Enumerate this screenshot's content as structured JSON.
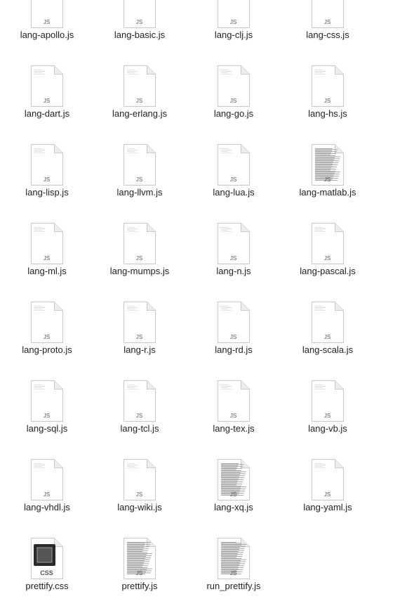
{
  "files": [
    {
      "name": "lang-apollo.js",
      "ext": "JS",
      "icon": "js-file-icon",
      "dense": false
    },
    {
      "name": "lang-basic.js",
      "ext": "JS",
      "icon": "js-file-icon",
      "dense": false
    },
    {
      "name": "lang-clj.js",
      "ext": "JS",
      "icon": "js-file-icon",
      "dense": false
    },
    {
      "name": "lang-css.js",
      "ext": "JS",
      "icon": "js-file-icon",
      "dense": false
    },
    {
      "name": "lang-dart.js",
      "ext": "JS",
      "icon": "js-file-icon",
      "dense": false
    },
    {
      "name": "lang-erlang.js",
      "ext": "JS",
      "icon": "js-file-icon",
      "dense": false
    },
    {
      "name": "lang-go.js",
      "ext": "JS",
      "icon": "js-file-icon",
      "dense": false
    },
    {
      "name": "lang-hs.js",
      "ext": "JS",
      "icon": "js-file-icon",
      "dense": false
    },
    {
      "name": "lang-lisp.js",
      "ext": "JS",
      "icon": "js-file-icon",
      "dense": false
    },
    {
      "name": "lang-llvm.js",
      "ext": "JS",
      "icon": "js-file-icon",
      "dense": false
    },
    {
      "name": "lang-lua.js",
      "ext": "JS",
      "icon": "js-file-icon",
      "dense": false
    },
    {
      "name": "lang-matlab.js",
      "ext": "JS",
      "icon": "js-file-icon",
      "dense": true
    },
    {
      "name": "lang-ml.js",
      "ext": "JS",
      "icon": "js-file-icon",
      "dense": false
    },
    {
      "name": "lang-mumps.js",
      "ext": "JS",
      "icon": "js-file-icon",
      "dense": false
    },
    {
      "name": "lang-n.js",
      "ext": "JS",
      "icon": "js-file-icon",
      "dense": false
    },
    {
      "name": "lang-pascal.js",
      "ext": "JS",
      "icon": "js-file-icon",
      "dense": false
    },
    {
      "name": "lang-proto.js",
      "ext": "JS",
      "icon": "js-file-icon",
      "dense": false
    },
    {
      "name": "lang-r.js",
      "ext": "JS",
      "icon": "js-file-icon",
      "dense": false
    },
    {
      "name": "lang-rd.js",
      "ext": "JS",
      "icon": "js-file-icon",
      "dense": false
    },
    {
      "name": "lang-scala.js",
      "ext": "JS",
      "icon": "js-file-icon",
      "dense": false
    },
    {
      "name": "lang-sql.js",
      "ext": "JS",
      "icon": "js-file-icon",
      "dense": false
    },
    {
      "name": "lang-tcl.js",
      "ext": "JS",
      "icon": "js-file-icon",
      "dense": false
    },
    {
      "name": "lang-tex.js",
      "ext": "JS",
      "icon": "js-file-icon",
      "dense": false
    },
    {
      "name": "lang-vb.js",
      "ext": "JS",
      "icon": "js-file-icon",
      "dense": false
    },
    {
      "name": "lang-vhdl.js",
      "ext": "JS",
      "icon": "js-file-icon",
      "dense": false
    },
    {
      "name": "lang-wiki.js",
      "ext": "JS",
      "icon": "js-file-icon",
      "dense": false
    },
    {
      "name": "lang-xq.js",
      "ext": "JS",
      "icon": "js-file-icon",
      "dense": true
    },
    {
      "name": "lang-yaml.js",
      "ext": "JS",
      "icon": "js-file-icon",
      "dense": false
    },
    {
      "name": "prettify.css",
      "ext": "CSS",
      "icon": "css-file-icon",
      "dense": false
    },
    {
      "name": "prettify.js",
      "ext": "JS",
      "icon": "js-file-icon",
      "dense": true
    },
    {
      "name": "run_prettify.js",
      "ext": "JS",
      "icon": "js-file-icon",
      "dense": true
    }
  ]
}
